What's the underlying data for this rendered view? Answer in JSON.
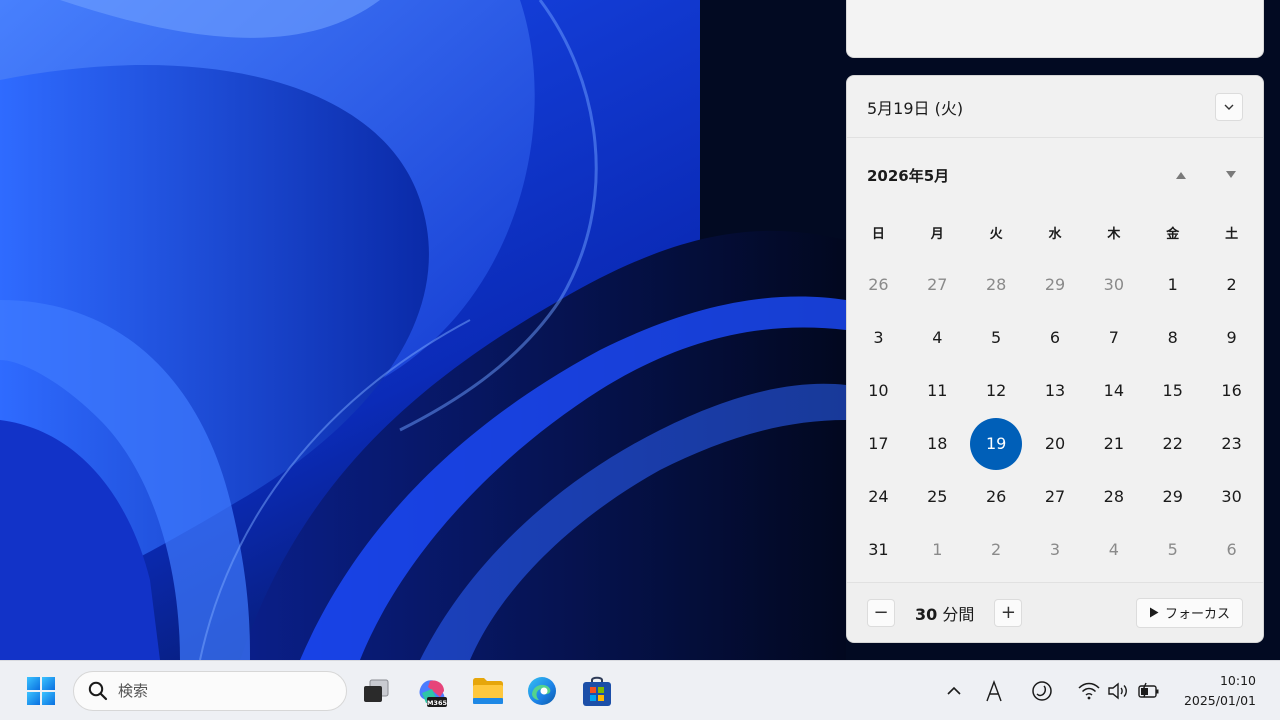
{
  "calendar": {
    "header_date": "5月19日 (火)",
    "month_title": "2026年5月",
    "weekdays": [
      "日",
      "月",
      "火",
      "水",
      "木",
      "金",
      "土"
    ],
    "weeks": [
      [
        {
          "d": "26",
          "other": true
        },
        {
          "d": "27",
          "other": true
        },
        {
          "d": "28",
          "other": true
        },
        {
          "d": "29",
          "other": true
        },
        {
          "d": "30",
          "other": true
        },
        {
          "d": "1"
        },
        {
          "d": "2"
        }
      ],
      [
        {
          "d": "3"
        },
        {
          "d": "4"
        },
        {
          "d": "5"
        },
        {
          "d": "6"
        },
        {
          "d": "7"
        },
        {
          "d": "8"
        },
        {
          "d": "9"
        }
      ],
      [
        {
          "d": "10"
        },
        {
          "d": "11"
        },
        {
          "d": "12"
        },
        {
          "d": "13"
        },
        {
          "d": "14"
        },
        {
          "d": "15"
        },
        {
          "d": "16"
        }
      ],
      [
        {
          "d": "17"
        },
        {
          "d": "18"
        },
        {
          "d": "19",
          "today": true
        },
        {
          "d": "20"
        },
        {
          "d": "21"
        },
        {
          "d": "22"
        },
        {
          "d": "23"
        }
      ],
      [
        {
          "d": "24"
        },
        {
          "d": "25"
        },
        {
          "d": "26"
        },
        {
          "d": "27"
        },
        {
          "d": "28"
        },
        {
          "d": "29"
        },
        {
          "d": "30"
        }
      ],
      [
        {
          "d": "31"
        },
        {
          "d": "1",
          "other": true
        },
        {
          "d": "2",
          "other": true
        },
        {
          "d": "3",
          "other": true
        },
        {
          "d": "4",
          "other": true
        },
        {
          "d": "5",
          "other": true
        },
        {
          "d": "6",
          "other": true
        }
      ]
    ],
    "selected_color": "#005fb8"
  },
  "focus": {
    "minutes": "30",
    "unit": "分間",
    "decrease_label": "−",
    "increase_label": "+",
    "start_label": "フォーカス"
  },
  "taskbar": {
    "search_placeholder": "検索",
    "apps": [
      "windows-start-icon",
      "task-view-icon",
      "microsoft-365-copilot-icon",
      "file-explorer-icon",
      "edge-icon",
      "microsoft-store-icon"
    ],
    "tray": [
      "chevron-up-icon",
      "ime-icon",
      "focus-moon-icon",
      "wifi-icon",
      "volume-icon",
      "battery-icon"
    ]
  },
  "clock": {
    "time": "10:10",
    "date": "2025/01/01"
  }
}
